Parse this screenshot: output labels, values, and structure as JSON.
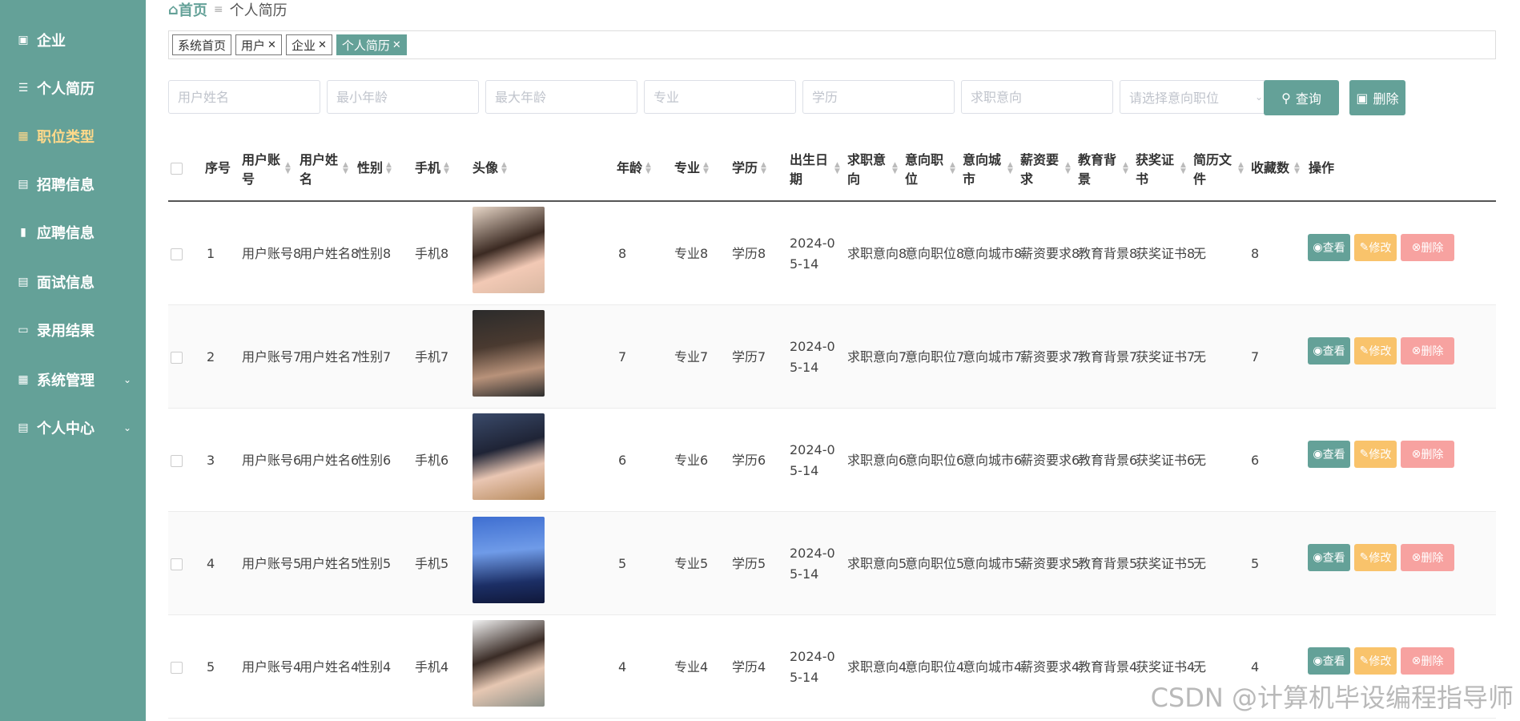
{
  "sidebar": {
    "items": [
      {
        "label": "企业",
        "icon": "briefcase-icon"
      },
      {
        "label": "个人简历",
        "icon": "list-icon"
      },
      {
        "label": "职位类型",
        "icon": "grid-icon"
      },
      {
        "label": "招聘信息",
        "icon": "clipboard-icon"
      },
      {
        "label": "应聘信息",
        "icon": "comment-icon"
      },
      {
        "label": "面试信息",
        "icon": "clipboard-icon"
      },
      {
        "label": "录用结果",
        "icon": "monitor-icon"
      },
      {
        "label": "系统管理",
        "icon": "grid-icon"
      },
      {
        "label": "个人中心",
        "icon": "calendar-icon"
      }
    ],
    "active_color": "#ffd98a",
    "bg_color": "#64a198"
  },
  "breadcrumb": {
    "home": "首页",
    "current": "个人简历"
  },
  "tags": [
    "系统首页",
    "用户",
    "企业",
    "个人简历"
  ],
  "search": {
    "placeholders": [
      "用户姓名",
      "最小年龄",
      "最大年龄",
      "专业",
      "学历",
      "求职意向"
    ],
    "select_placeholder": "请选择意向职位",
    "query_label": "查询",
    "delete_label": "删除"
  },
  "table": {
    "headers": {
      "index": "序号",
      "account": "用户账号",
      "name": "用户姓名",
      "gender": "性别",
      "phone": "手机",
      "avatar": "头像",
      "age": "年龄",
      "major": "专业",
      "education": "学历",
      "birth": "出生日期",
      "intention": "求职意向",
      "position": "意向职位",
      "city": "意向城市",
      "salary": "薪资要求",
      "background": "教育背景",
      "award": "获奖证书",
      "file": "简历文件",
      "favorites": "收藏数",
      "ops": "操作"
    },
    "rows": [
      {
        "index": "1",
        "account": "用户账号8",
        "name": "用户姓名8",
        "gender": "性别8",
        "phone": "手机8",
        "age": "8",
        "major": "专业8",
        "education": "学历8",
        "birth": "2024-05-14",
        "intention": "求职意向8",
        "position": "意向职位8",
        "city": "意向城市8",
        "salary": "薪资要求8",
        "background": "教育背景8",
        "award": "获奖证书8",
        "file": "无",
        "favorites": "8"
      },
      {
        "index": "2",
        "account": "用户账号7",
        "name": "用户姓名7",
        "gender": "性别7",
        "phone": "手机7",
        "age": "7",
        "major": "专业7",
        "education": "学历7",
        "birth": "2024-05-14",
        "intention": "求职意向7",
        "position": "意向职位7",
        "city": "意向城市7",
        "salary": "薪资要求7",
        "background": "教育背景7",
        "award": "获奖证书7",
        "file": "无",
        "favorites": "7"
      },
      {
        "index": "3",
        "account": "用户账号6",
        "name": "用户姓名6",
        "gender": "性别6",
        "phone": "手机6",
        "age": "6",
        "major": "专业6",
        "education": "学历6",
        "birth": "2024-05-14",
        "intention": "求职意向6",
        "position": "意向职位6",
        "city": "意向城市6",
        "salary": "薪资要求6",
        "background": "教育背景6",
        "award": "获奖证书6",
        "file": "无",
        "favorites": "6"
      },
      {
        "index": "4",
        "account": "用户账号5",
        "name": "用户姓名5",
        "gender": "性别5",
        "phone": "手机5",
        "age": "5",
        "major": "专业5",
        "education": "学历5",
        "birth": "2024-05-14",
        "intention": "求职意向5",
        "position": "意向职位5",
        "city": "意向城市5",
        "salary": "薪资要求5",
        "background": "教育背景5",
        "award": "获奖证书5",
        "file": "无",
        "favorites": "5"
      },
      {
        "index": "5",
        "account": "用户账号4",
        "name": "用户姓名4",
        "gender": "性别4",
        "phone": "手机4",
        "age": "4",
        "major": "专业4",
        "education": "学历4",
        "birth": "2024-05-14",
        "intention": "求职意向4",
        "position": "意向职位4",
        "city": "意向城市4",
        "salary": "薪资要求4",
        "background": "教育背景4",
        "award": "获奖证书4",
        "file": "无",
        "favorites": "4"
      }
    ],
    "ops": {
      "view": "查看",
      "edit": "修改",
      "delete": "删除"
    }
  },
  "watermark": "CSDN @计算机毕设编程指导师"
}
